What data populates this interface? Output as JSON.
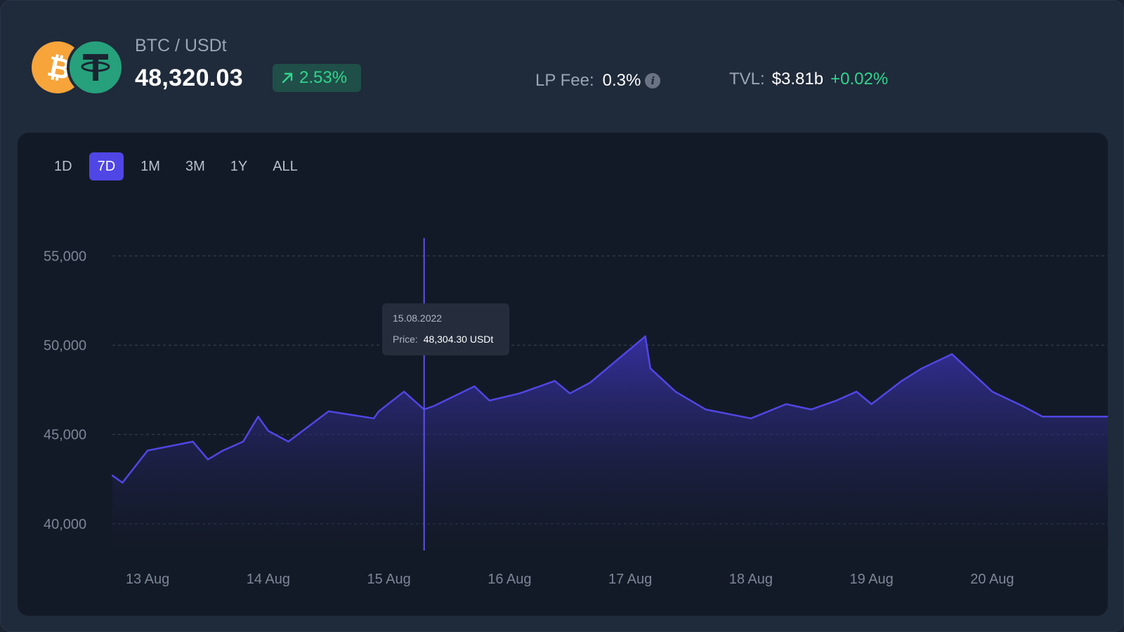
{
  "header": {
    "pair": "BTC / USDt",
    "price": "48,320.03",
    "change": "2.53%",
    "lp_fee_label": "LP Fee:",
    "lp_fee_value": "0.3%",
    "info_icon_glyph": "i",
    "tvl_label": "TVL:",
    "tvl_value": "$3.81b",
    "tvl_change": "+0.02%"
  },
  "ranges": [
    {
      "label": "1D",
      "active": false
    },
    {
      "label": "7D",
      "active": true
    },
    {
      "label": "1M",
      "active": false
    },
    {
      "label": "3M",
      "active": false
    },
    {
      "label": "1Y",
      "active": false
    },
    {
      "label": "ALL",
      "active": false
    }
  ],
  "tooltip": {
    "date": "15.08.2022",
    "price_label": "Price:",
    "price_value": "48,304.30 USDt"
  },
  "colors": {
    "accent": "#4f46e5",
    "line": "#5046e4",
    "positive": "#31d58d",
    "btc": "#f7a43a",
    "usdt": "#26a17b"
  },
  "icons": {
    "base": "bitcoin-icon",
    "quote": "tether-icon",
    "change": "arrow-up-right-icon",
    "info": "info-icon"
  },
  "chart_data": {
    "type": "area",
    "title": "",
    "xlabel": "",
    "ylabel": "",
    "ylim": [
      38500,
      56000
    ],
    "xlim": [
      "2022-08-12T17:00",
      "2022-08-20T23:00"
    ],
    "y_ticks": [
      "40,000",
      "45,000",
      "50,000",
      "55,000"
    ],
    "y_tick_values": [
      40000,
      45000,
      50000,
      55000
    ],
    "x_ticks": [
      "13 Aug",
      "14 Aug",
      "15 Aug",
      "16 Aug",
      "17 Aug",
      "18 Aug",
      "19 Aug",
      "20 Aug"
    ],
    "x_tick_dates": [
      "2022-08-13T00:00",
      "2022-08-14T00:00",
      "2022-08-15T00:00",
      "2022-08-16T00:00",
      "2022-08-17T00:00",
      "2022-08-18T00:00",
      "2022-08-19T00:00",
      "2022-08-20T00:00"
    ],
    "grid": true,
    "hover_date": "2022-08-15T07:00",
    "series": [
      {
        "x": [
          "2022-08-12T17:00",
          "2022-08-12T19:00",
          "2022-08-13T00:00",
          "2022-08-13T09:00",
          "2022-08-13T12:00",
          "2022-08-13T15:00",
          "2022-08-13T19:00",
          "2022-08-13T22:00",
          "2022-08-14T00:00",
          "2022-08-14T04:00",
          "2022-08-14T12:00",
          "2022-08-14T21:00",
          "2022-08-14T22:00",
          "2022-08-15T03:00",
          "2022-08-15T07:00",
          "2022-08-15T09:00",
          "2022-08-15T17:00",
          "2022-08-15T20:00",
          "2022-08-16T02:00",
          "2022-08-16T09:00",
          "2022-08-16T12:00",
          "2022-08-16T16:00",
          "2022-08-17T03:00",
          "2022-08-17T04:00",
          "2022-08-17T09:00",
          "2022-08-17T15:00",
          "2022-08-18T00:00",
          "2022-08-18T07:00",
          "2022-08-18T12:00",
          "2022-08-18T17:00",
          "2022-08-18T21:00",
          "2022-08-19T00:00",
          "2022-08-19T06:00",
          "2022-08-19T10:00",
          "2022-08-19T16:00",
          "2022-08-20T00:00",
          "2022-08-20T06:00",
          "2022-08-20T10:00",
          "2022-08-20T16:00",
          "2022-08-20T23:00"
        ],
        "values": [
          42700,
          42300,
          44100,
          44600,
          43600,
          44100,
          44600,
          46000,
          45200,
          44600,
          46300,
          45900,
          46300,
          47400,
          46400,
          46600,
          47700,
          46900,
          47300,
          48000,
          47300,
          47900,
          50500,
          48700,
          47400,
          46400,
          45900,
          46700,
          46400,
          46900,
          47400,
          46700,
          48000,
          48700,
          49500,
          47400,
          46600,
          46000,
          46000,
          46000
        ]
      }
    ]
  }
}
